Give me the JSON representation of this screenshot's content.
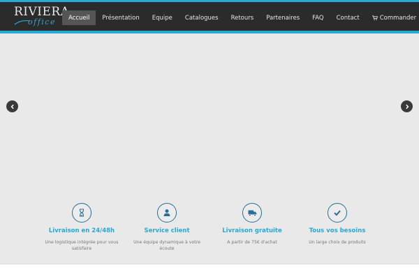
{
  "brand": {
    "name": "RIVIERA",
    "sub": "office"
  },
  "nav": {
    "items": [
      {
        "label": "Accueil",
        "active": true
      },
      {
        "label": "Présentation"
      },
      {
        "label": "Equipe"
      },
      {
        "label": "Catalogues"
      },
      {
        "label": "Retours"
      },
      {
        "label": "Partenaires"
      },
      {
        "label": "FAQ"
      },
      {
        "label": "Contact"
      },
      {
        "label": "Commander",
        "icon": "cart-icon"
      }
    ]
  },
  "slider": {
    "prev_icon": "chevron-left-icon",
    "next_icon": "chevron-right-icon"
  },
  "features": [
    {
      "icon": "hourglass-icon",
      "title": "Livraison en 24/48h",
      "desc": "Une logistique intégrée pour vous satisfaire"
    },
    {
      "icon": "user-icon",
      "title": "Service client",
      "desc": "Une équipe dynamique à votre écoute"
    },
    {
      "icon": "truck-icon",
      "title": "Livraison gratuite",
      "desc": "A partir de 75€ d'achat"
    },
    {
      "icon": "check-icon",
      "title": "Tous vos besoins",
      "desc": "Un large choix de produits"
    }
  ],
  "colors": {
    "accent": "#27a9d6",
    "navbar": "#2b2b2b",
    "icon_border": "#2b6e97"
  }
}
